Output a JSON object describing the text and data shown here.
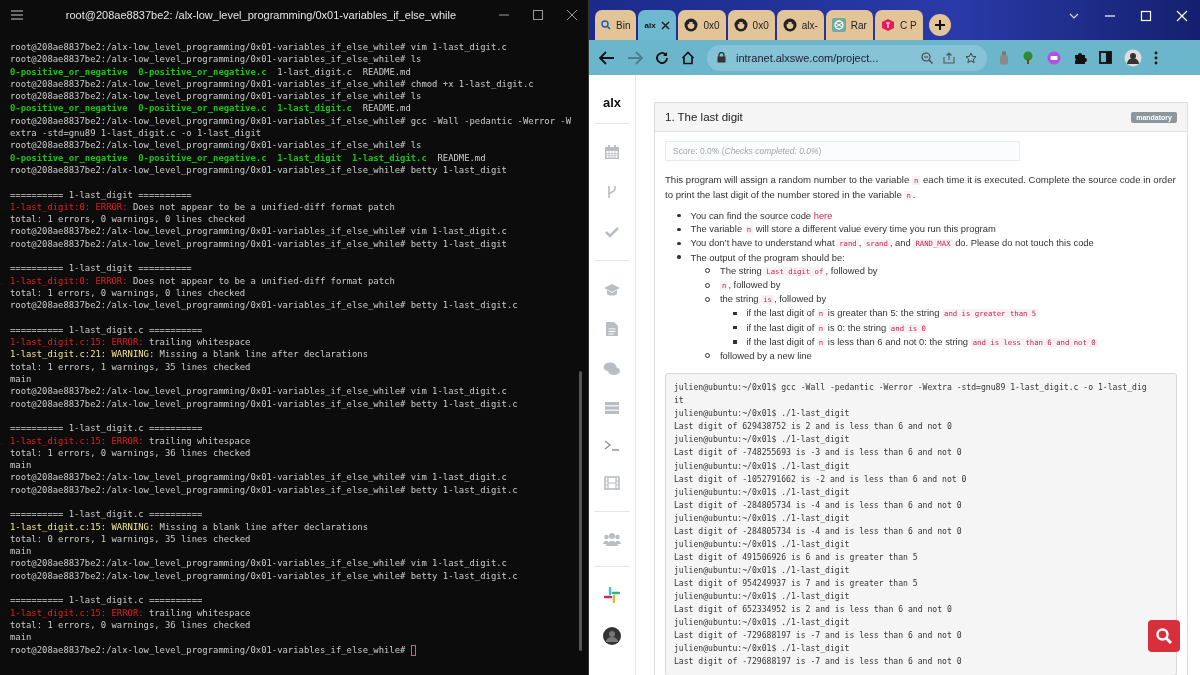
{
  "terminal": {
    "title": "root@208ae8837be2: /alx-low_level_programming/0x01-variables_if_else_while",
    "lines": [
      {
        "parts": [
          {
            "text": "root@208ae8837be2:/alx-low_level_programming/0x01-variables_if_else_while# vim 1-last_digit.c",
            "kind": "output"
          }
        ]
      },
      {
        "parts": [
          {
            "text": "root@208ae8837be2:/alx-low_level_programming/0x01-variables_if_else_while# ls",
            "kind": "output"
          }
        ]
      },
      {
        "parts": [
          {
            "text": "0-positive_or_negative  0-positive_or_negative.c",
            "kind": "listing"
          },
          {
            "text": "  1-last_digit.c  README.md",
            "kind": "output"
          }
        ]
      },
      {
        "parts": [
          {
            "text": "root@208ae8837be2:/alx-low_level_programming/0x01-variables_if_else_while# chmod +x 1-last_digit.c",
            "kind": "output"
          }
        ]
      },
      {
        "parts": [
          {
            "text": "root@208ae8837be2:/alx-low_level_programming/0x01-variables_if_else_while# ls",
            "kind": "output"
          }
        ]
      },
      {
        "parts": [
          {
            "text": "0-positive_or_negative  0-positive_or_negative.c  1-last_digit.c",
            "kind": "listing"
          },
          {
            "text": "  README.md",
            "kind": "output"
          }
        ]
      },
      {
        "parts": [
          {
            "text": "root@208ae8837be2:/alx-low_level_programming/0x01-variables_if_else_while# gcc -Wall -pedantic -Werror -W",
            "kind": "output"
          }
        ]
      },
      {
        "parts": [
          {
            "text": "extra -std=gnu89 1-last_digit.c -o 1-last_digit",
            "kind": "output"
          }
        ]
      },
      {
        "parts": [
          {
            "text": "root@208ae8837be2:/alx-low_level_programming/0x01-variables_if_else_while# ls",
            "kind": "output"
          }
        ]
      },
      {
        "parts": [
          {
            "text": "0-positive_or_negative  0-positive_or_negative.c  1-last_digit  1-last_digit.c",
            "kind": "listing"
          },
          {
            "text": "  README.md",
            "kind": "output"
          }
        ]
      },
      {
        "parts": [
          {
            "text": "root@208ae8837be2:/alx-low_level_programming/0x01-variables_if_else_while# betty 1-last_digit",
            "kind": "output"
          }
        ]
      },
      {
        "gap_before": true,
        "parts": [
          {
            "text": "========== 1-last_digit ==========",
            "kind": "output"
          }
        ]
      },
      {
        "parts": [
          {
            "text": "1-last_digit:0: ERROR:",
            "kind": "error"
          },
          {
            "text": " Does not appear to be a unified-diff format patch",
            "kind": "output"
          }
        ]
      },
      {
        "parts": [
          {
            "text": "total: 1 errors, 0 warnings, 0 lines checked",
            "kind": "output"
          }
        ]
      },
      {
        "parts": [
          {
            "text": "root@208ae8837be2:/alx-low_level_programming/0x01-variables_if_else_while# vim 1-last_digit.c",
            "kind": "output"
          }
        ]
      },
      {
        "parts": [
          {
            "text": "root@208ae8837be2:/alx-low_level_programming/0x01-variables_if_else_while# betty 1-last_digit",
            "kind": "output"
          }
        ]
      },
      {
        "gap_before": true,
        "parts": [
          {
            "text": "========== 1-last_digit ==========",
            "kind": "output"
          }
        ]
      },
      {
        "parts": [
          {
            "text": "1-last_digit:0: ERROR:",
            "kind": "error"
          },
          {
            "text": " Does not appear to be a unified-diff format patch",
            "kind": "output"
          }
        ]
      },
      {
        "parts": [
          {
            "text": "total: 1 errors, 0 warnings, 0 lines checked",
            "kind": "output"
          }
        ]
      },
      {
        "parts": [
          {
            "text": "root@208ae8837be2:/alx-low_level_programming/0x01-variables_if_else_while# betty 1-last_digit.c",
            "kind": "output"
          }
        ]
      },
      {
        "gap_before": true,
        "parts": [
          {
            "text": "========== 1-last_digit.c ==========",
            "kind": "output"
          }
        ]
      },
      {
        "parts": [
          {
            "text": "1-last_digit.c:15: ERROR:",
            "kind": "error"
          },
          {
            "text": " trailing whitespace",
            "kind": "output"
          }
        ]
      },
      {
        "parts": [
          {
            "text": "1-last_digit.c:21: WARNING:",
            "kind": "warning"
          },
          {
            "text": " Missing a blank line after declarations",
            "kind": "output"
          }
        ]
      },
      {
        "parts": [
          {
            "text": "total: 1 errors, 1 warnings, 35 lines checked",
            "kind": "output"
          }
        ]
      },
      {
        "parts": [
          {
            "text": "main",
            "kind": "output"
          }
        ]
      },
      {
        "parts": [
          {
            "text": "root@208ae8837be2:/alx-low_level_programming/0x01-variables_if_else_while# vim 1-last_digit.c",
            "kind": "output"
          }
        ]
      },
      {
        "parts": [
          {
            "text": "root@208ae8837be2:/alx-low_level_programming/0x01-variables_if_else_while# betty 1-last_digit.c",
            "kind": "output"
          }
        ]
      },
      {
        "gap_before": true,
        "parts": [
          {
            "text": "========== 1-last_digit.c ==========",
            "kind": "output"
          }
        ]
      },
      {
        "parts": [
          {
            "text": "1-last_digit.c:15: ERROR:",
            "kind": "error"
          },
          {
            "text": " trailing whitespace",
            "kind": "output"
          }
        ]
      },
      {
        "parts": [
          {
            "text": "total: 1 errors, 0 warnings, 36 lines checked",
            "kind": "output"
          }
        ]
      },
      {
        "parts": [
          {
            "text": "main",
            "kind": "output"
          }
        ]
      },
      {
        "parts": [
          {
            "text": "root@208ae8837be2:/alx-low_level_programming/0x01-variables_if_else_while# vim 1-last_digit.c",
            "kind": "output"
          }
        ]
      },
      {
        "parts": [
          {
            "text": "root@208ae8837be2:/alx-low_level_programming/0x01-variables_if_else_while# betty 1-last_digit.c",
            "kind": "output"
          }
        ]
      },
      {
        "gap_before": true,
        "parts": [
          {
            "text": "========== 1-last_digit.c ==========",
            "kind": "output"
          }
        ]
      },
      {
        "parts": [
          {
            "text": "1-last_digit.c:15: WARNING:",
            "kind": "warning"
          },
          {
            "text": " Missing a blank line after declarations",
            "kind": "output"
          }
        ]
      },
      {
        "parts": [
          {
            "text": "total: 0 errors, 1 warnings, 35 lines checked",
            "kind": "output"
          }
        ]
      },
      {
        "parts": [
          {
            "text": "main",
            "kind": "output"
          }
        ]
      },
      {
        "parts": [
          {
            "text": "root@208ae8837be2:/alx-low_level_programming/0x01-variables_if_else_while# vim 1-last_digit.c",
            "kind": "output"
          }
        ]
      },
      {
        "parts": [
          {
            "text": "root@208ae8837be2:/alx-low_level_programming/0x01-variables_if_else_while# betty 1-last_digit.c",
            "kind": "output"
          }
        ]
      },
      {
        "gap_before": true,
        "parts": [
          {
            "text": "========== 1-last_digit.c ==========",
            "kind": "output"
          }
        ]
      },
      {
        "parts": [
          {
            "text": "1-last_digit.c:15: ERROR:",
            "kind": "error"
          },
          {
            "text": " trailing whitespace",
            "kind": "output"
          }
        ]
      },
      {
        "parts": [
          {
            "text": "total: 1 errors, 0 warnings, 36 lines checked",
            "kind": "output"
          }
        ]
      },
      {
        "parts": [
          {
            "text": "main",
            "kind": "output"
          }
        ]
      },
      {
        "cursor": true,
        "parts": [
          {
            "text": "root@208ae8837be2:/alx-low_level_programming/0x01-variables_if_else_while# ",
            "kind": "output"
          }
        ]
      }
    ]
  },
  "browser": {
    "tabs": [
      {
        "kind": "search",
        "label": "Bin",
        "selected": false
      },
      {
        "kind": "logo",
        "label": "alx",
        "selected": true
      },
      {
        "kind": "github",
        "label": "0x0",
        "selected": false
      },
      {
        "kind": "github",
        "label": "0x0",
        "selected": false
      },
      {
        "kind": "github",
        "label": "alx-",
        "selected": false
      },
      {
        "kind": "knot",
        "label": "Rar",
        "selected": false
      },
      {
        "kind": "cube",
        "label": "C P",
        "selected": false
      }
    ],
    "address": "intranet.alxswe.com/project...",
    "page": {
      "logo": "alx",
      "card": {
        "title": "1. The last digit",
        "badge": "mandatory",
        "score": "Score: 0.0% (*Checks completed: 0.0%*)",
        "intro": [
          {
            "text": "This program will assign a random number to the variable ",
            "kind": "text"
          },
          {
            "text": "n",
            "kind": "code"
          },
          {
            "text": " each time it is executed. Complete the source code in order to print the last digit of the number stored in the variable ",
            "kind": "text"
          },
          {
            "text": "n",
            "kind": "code"
          },
          {
            "text": ".",
            "kind": "text"
          }
        ],
        "bullets": [
          {
            "parts": [
              {
                "text": "You can find the source code ",
                "kind": "text"
              },
              {
                "text": "here",
                "kind": "link"
              }
            ]
          },
          {
            "parts": [
              {
                "text": "The variable ",
                "kind": "text"
              },
              {
                "text": "n",
                "kind": "code"
              },
              {
                "text": " will store a different value every time you run this program",
                "kind": "text"
              }
            ]
          },
          {
            "parts": [
              {
                "text": "You don’t have to understand what ",
                "kind": "text"
              },
              {
                "text": "rand",
                "kind": "code"
              },
              {
                "text": ", ",
                "kind": "text"
              },
              {
                "text": "srand",
                "kind": "code"
              },
              {
                "text": ", and ",
                "kind": "text"
              },
              {
                "text": "RAND_MAX",
                "kind": "code"
              },
              {
                "text": " do. Please do not touch this code",
                "kind": "text"
              }
            ]
          },
          {
            "parts": [
              {
                "text": "The output of the program should be:",
                "kind": "text"
              }
            ],
            "children": [
              {
                "parts": [
                  {
                    "text": "The string ",
                    "kind": "text"
                  },
                  {
                    "text": "Last digit of",
                    "kind": "code"
                  },
                  {
                    "text": ", followed by",
                    "kind": "text"
                  }
                ]
              },
              {
                "parts": [
                  {
                    "text": "n",
                    "kind": "code"
                  },
                  {
                    "text": ", followed by",
                    "kind": "text"
                  }
                ]
              },
              {
                "parts": [
                  {
                    "text": "the string ",
                    "kind": "text"
                  },
                  {
                    "text": "is",
                    "kind": "code"
                  },
                  {
                    "text": ", followed by",
                    "kind": "text"
                  }
                ],
                "children": [
                  {
                    "parts": [
                      {
                        "text": "if the last digit of ",
                        "kind": "text"
                      },
                      {
                        "text": "n",
                        "kind": "code"
                      },
                      {
                        "text": " is greater than 5: the string ",
                        "kind": "text"
                      },
                      {
                        "text": "and is greater than 5",
                        "kind": "code"
                      }
                    ]
                  },
                  {
                    "parts": [
                      {
                        "text": "if the last digit of ",
                        "kind": "text"
                      },
                      {
                        "text": "n",
                        "kind": "code"
                      },
                      {
                        "text": " is 0: the string ",
                        "kind": "text"
                      },
                      {
                        "text": "and is 0",
                        "kind": "code"
                      }
                    ]
                  },
                  {
                    "parts": [
                      {
                        "text": "if the last digit of ",
                        "kind": "text"
                      },
                      {
                        "text": "n",
                        "kind": "code"
                      },
                      {
                        "text": " is less than 6 and not 0: the string ",
                        "kind": "text"
                      },
                      {
                        "text": "and is less than 6 and not 0",
                        "kind": "code"
                      }
                    ]
                  }
                ]
              },
              {
                "parts": [
                  {
                    "text": "followed by a new line",
                    "kind": "text"
                  }
                ]
              }
            ]
          }
        ],
        "code": [
          "julien@ubuntu:~/0x01$ gcc -Wall -pedantic -Werror -Wextra -std=gnu89 1-last_digit.c -o 1-last_dig",
          "it",
          "julien@ubuntu:~/0x01$ ./1-last_digit",
          "Last digit of 629438752 is 2 and is less than 6 and not 0",
          "julien@ubuntu:~/0x01$ ./1-last_digit",
          "Last digit of -748255693 is -3 and is less than 6 and not 0",
          "julien@ubuntu:~/0x01$ ./1-last_digit",
          "Last digit of -1052791662 is -2 and is less than 6 and not 0",
          "julien@ubuntu:~/0x01$ ./1-last_digit",
          "Last digit of -284805734 is -4 and is less than 6 and not 0",
          "julien@ubuntu:~/0x01$ ./1-last_digit",
          "Last digit of -284805734 is -4 and is less than 6 and not 0",
          "julien@ubuntu:~/0x01$ ./1-last_digit",
          "Last digit of 491506926 is 6 and is greater than 5",
          "julien@ubuntu:~/0x01$ ./1-last_digit",
          "Last digit of 954249937 is 7 and is greater than 5",
          "julien@ubuntu:~/0x01$ ./1-last_digit",
          "Last digit of 652334952 is 2 and is less than 6 and not 0",
          "julien@ubuntu:~/0x01$ ./1-last_digit",
          "Last digit of -729688197 is -7 and is less than 6 and not 0",
          "julien@ubuntu:~/0x01$ ./1-last_digit",
          "Last digit of -729688197 is -7 and is less than 6 and not 0"
        ]
      }
    }
  }
}
